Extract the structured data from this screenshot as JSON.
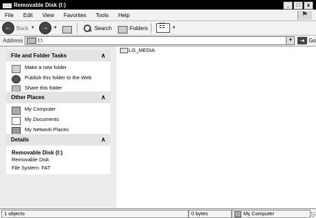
{
  "window": {
    "title": "Removable Disk (I:)",
    "controls": {
      "minimize": "_",
      "maximize": "□",
      "close": "x"
    }
  },
  "menu": [
    "File",
    "Edit",
    "View",
    "Favorites",
    "Tools",
    "Help"
  ],
  "toolbar": {
    "back_label": "Back",
    "search_label": "Search",
    "folders_label": "Folders"
  },
  "address": {
    "label": "Address",
    "value": "I:\\",
    "go_label": "Go"
  },
  "side": {
    "file_tasks": {
      "title": "File and Folder Tasks",
      "items": [
        {
          "label": "Make a new folder",
          "icon": "new-folder-icon"
        },
        {
          "label": "Publish this folder to the Web",
          "icon": "globe-icon"
        },
        {
          "label": "Share this folder",
          "icon": "share-icon"
        }
      ]
    },
    "other_places": {
      "title": "Other Places",
      "items": [
        {
          "label": "My Computer",
          "icon": "computer-icon"
        },
        {
          "label": "My Documents",
          "icon": "documents-icon"
        },
        {
          "label": "My Network Places",
          "icon": "network-icon"
        }
      ]
    },
    "details": {
      "title": "Details",
      "name": "Removable Disk (I:)",
      "type": "Removable Disk",
      "filesystem": "File System: FAT"
    }
  },
  "files": [
    {
      "name": "LG_MEDIA",
      "icon": "folder-icon"
    }
  ],
  "status": {
    "objects": "1 objects",
    "size": "0 bytes",
    "location": "My Computer"
  }
}
